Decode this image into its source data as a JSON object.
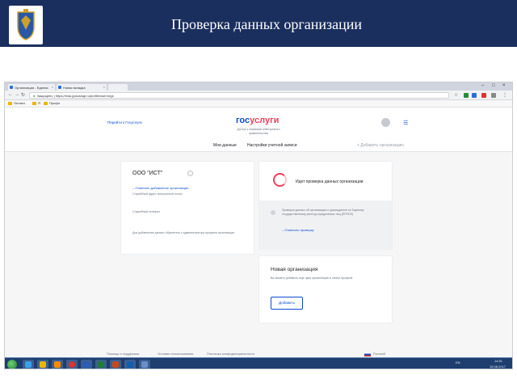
{
  "slide": {
    "title": "Проверка данных организации"
  },
  "browser": {
    "tabs": [
      {
        "label": "Организации - Единая"
      },
      {
        "label": "Новая вкладка"
      },
      {
        "label": ""
      }
    ],
    "secure_label": "Защищено",
    "url": "https://esia.gosuslugi.ru/profile/user/orgs",
    "bookmarks": [
      "Оплата",
      "Я",
      "Профи"
    ]
  },
  "site": {
    "back_link": "Перейти к Госуслуги",
    "logo_part1": "гос",
    "logo_part2": "услуги",
    "logo_subtitle": "Доступ к сервисам электронного правительства",
    "subnav": {
      "my_data": "Мои данные",
      "settings": "Настройки учетной записи",
      "add_org": "+ Добавить организацию"
    }
  },
  "org_card": {
    "name": "ООО \"ИСТ\"",
    "info_icon": "i",
    "cancel_link": "Отменить добавление организации",
    "note1": "Служебный адрес электронной почты",
    "note2": "Служебный телефон",
    "note3": "Для добавления данных обратитесь к администратору профиля организации"
  },
  "check_card": {
    "title": "Идет проверка данных организации",
    "notice": "Проверка данных об организации и руководителе по Единому государственному реестру юридических лиц (ЕГРЮЛ)",
    "cancel_check": "Отменить проверку"
  },
  "new_org_card": {
    "title": "Новая организация",
    "text": "Вы можете добавить еще одну организацию в своем профиле",
    "button": "Добавить"
  },
  "footer": {
    "help": "Помощь и поддержка",
    "terms": "Условия использования",
    "privacy": "Политика конфиденциальности",
    "language": "Русский"
  },
  "taskbar": {
    "lang": "EN",
    "time": "14:51",
    "date": "15.08.2017"
  },
  "icons": [
    "emblem-icon",
    "spinner-icon",
    "avatar-icon",
    "menu-icon",
    "start-icon"
  ],
  "colors": {
    "header_bg": "#1b2f5e",
    "brand_blue": "#0d4cd3",
    "brand_red": "#ee3f58",
    "taskbar": "#1d3e6e"
  }
}
